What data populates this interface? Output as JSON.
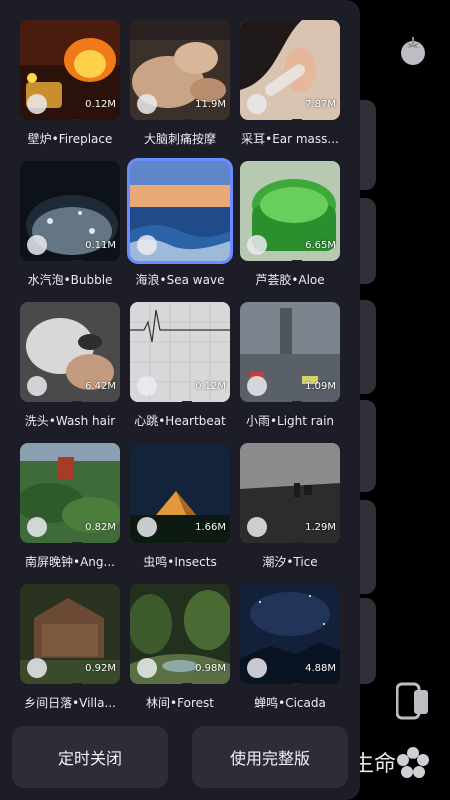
{
  "sounds": [
    {
      "label": "壁炉•Fireplace",
      "size": "0.12M",
      "state": "download"
    },
    {
      "label": "大脑刺痛按摩",
      "size": "11.9M",
      "state": "download"
    },
    {
      "label": "采耳•Ear mass...",
      "size": "7.87M",
      "state": "download"
    },
    {
      "label": "水汽泡•Bubble",
      "size": "0.11M",
      "state": "download"
    },
    {
      "label": "海浪•Sea wave",
      "size": "",
      "state": "playing"
    },
    {
      "label": "芦荟胶•Aloe",
      "size": "6.65M",
      "state": "download"
    },
    {
      "label": "洗头•Wash hair",
      "size": "6.42M",
      "state": "download"
    },
    {
      "label": "心跳•Heartbeat",
      "size": "0.12M",
      "state": "download"
    },
    {
      "label": "小雨•Light rain",
      "size": "1.09M",
      "state": "download"
    },
    {
      "label": "南屏晚钟•Ang...",
      "size": "0.82M",
      "state": "download"
    },
    {
      "label": "虫鸣•Insects",
      "size": "1.66M",
      "state": "download"
    },
    {
      "label": "潮汐•Tice",
      "size": "1.29M",
      "state": "download"
    },
    {
      "label": "乡间日落•Villa...",
      "size": "0.92M",
      "state": "download"
    },
    {
      "label": "林间•Forest",
      "size": "0.98M",
      "state": "download"
    },
    {
      "label": "蝉鸣•Cicada",
      "size": "4.88M",
      "state": "download"
    }
  ],
  "buttons": {
    "timer_label": "定时关闭",
    "full_version_label": "使用完整版"
  },
  "background": {
    "partial_text": "生命"
  },
  "colors": {
    "panel": "#1c1d26",
    "button": "#2c2d37",
    "accent_selected": "#6c8cff"
  },
  "icons": {
    "download": "download-arrow-icon",
    "playing": "pause-icon",
    "top_right": "tomato-icon",
    "bottom_right": "flower-gear-icon",
    "phone": "phone-icon"
  }
}
